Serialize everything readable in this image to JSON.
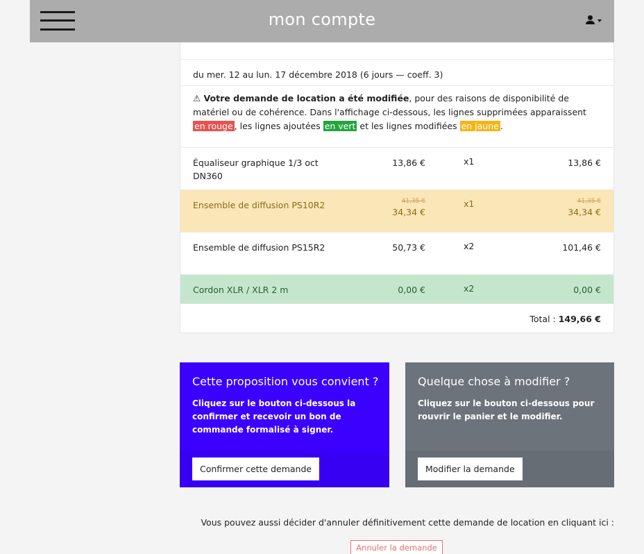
{
  "header": {
    "title": "mon compte",
    "menu_icon": "hamburger-menu-icon",
    "user_icon": "user-dropdown-icon"
  },
  "request": {
    "period": "du mer. 12 au lun. 17 décembre 2018 (6 jours — coeff. 3)",
    "notice": {
      "warning_icon": "warning-icon",
      "bold_text": "⚠ Votre demande de location a été modifiée",
      "text1": ", pour des raisons de disponibilité de matériel ou de cohérence. Dans l'affichage ci-dessous, les lignes supprimées apparaissent ",
      "red_label": "en rouge",
      "text2": ", les lignes ajoutées ",
      "green_label": "en vert",
      "text3": " et les lignes modifiées ",
      "yellow_label": "en jaune",
      "text4": "."
    },
    "items": [
      {
        "name": "Équaliseur graphique 1/3 oct DN360",
        "unit_price": "13,86 €",
        "qty": "x1",
        "total": "13,86 €"
      },
      {
        "name": "Ensemble de diffusion PS10R2",
        "old_unit_price": "41,35 €",
        "unit_price": "34,34 €",
        "qty": "x1",
        "old_total": "41,35 €",
        "total": "34,34 €"
      },
      {
        "name": "Ensemble de diffusion PS15R2",
        "unit_price": "50,73 €",
        "qty": "x2",
        "total": "101,46 €"
      },
      {
        "name": "Cordon XLR / XLR 2 m",
        "unit_price": "0,00 €",
        "qty": "x2",
        "total": "0,00 €"
      }
    ],
    "total_label": "Total : ",
    "total_value": "149,66 €"
  },
  "confirm_panel": {
    "title": "Cette proposition vous convient ?",
    "text": "Cliquez sur le bouton ci-dessous la confirmer et recevoir un bon de commande formalisé à signer.",
    "button": "Confirmer cette demande",
    "color": "#3b00ff"
  },
  "modify_panel": {
    "title": "Quelque chose à modifier ?",
    "text": "Cliquez sur le bouton ci-dessous pour rouvrir le panier et le modifier.",
    "button": "Modifier la demande",
    "color": "#6c737b"
  },
  "cancel": {
    "text": "Vous pouvez aussi décider d'annuler définitivement cette demande de location en cliquant ici :",
    "button": "Annuler la demande"
  }
}
